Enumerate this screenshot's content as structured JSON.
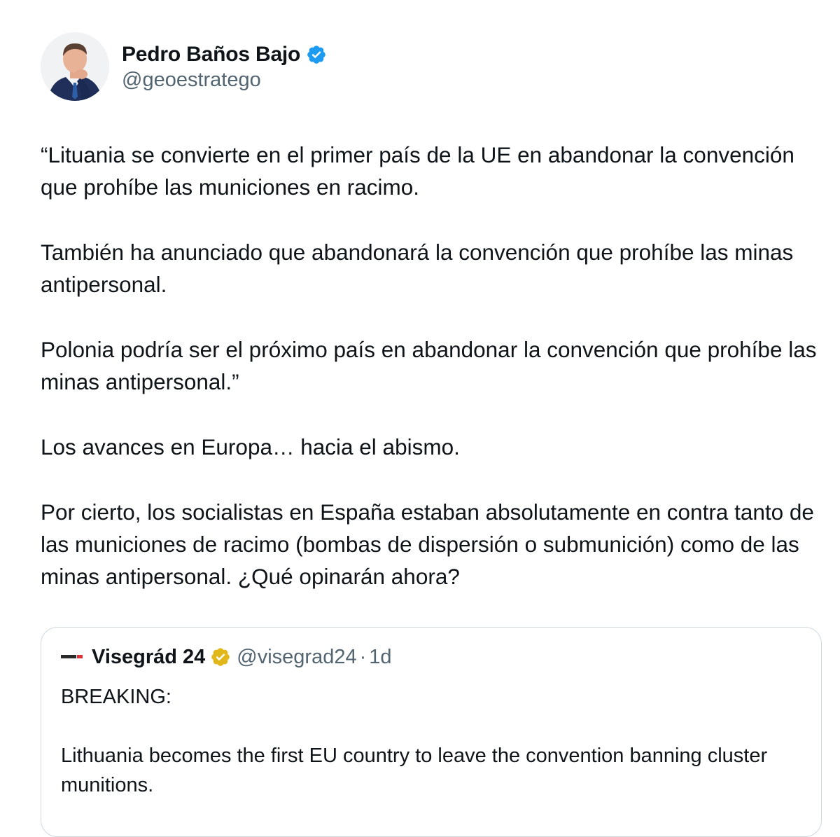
{
  "author": {
    "name": "Pedro Baños Bajo",
    "handle": "@geoestratego",
    "verified_color": "#1d9bf0"
  },
  "tweet": {
    "paragraphs": [
      "“Lituania se convierte en el primer país de la UE en abandonar la convención que prohíbe las municiones en racimo.",
      "También ha anunciado que abandonará la convención que prohíbe las minas antipersonal.",
      "Polonia podría ser el próximo país en abandonar la convención que prohíbe las minas antipersonal.”",
      "Los avances en Europa… hacia el abismo.",
      "Por cierto, los socialistas en España estaban absolutamente en contra tanto de las municiones de racimo (bombas de dispersión o submunición) como de las minas antipersonal. ¿Qué opinarán ahora?"
    ]
  },
  "quote": {
    "name": "Visegrád 24",
    "handle": "@visegrad24",
    "separator": "·",
    "time": "1d",
    "badge_color": "#e2b719",
    "paragraphs": [
      "BREAKING:",
      "Lithuania becomes the first EU country to leave the convention banning cluster munitions."
    ]
  },
  "icons": {
    "verified": "verified-badge-icon",
    "quote_verified": "gold-verified-badge-icon",
    "quote_logo": "visegrad-logo-icon"
  }
}
